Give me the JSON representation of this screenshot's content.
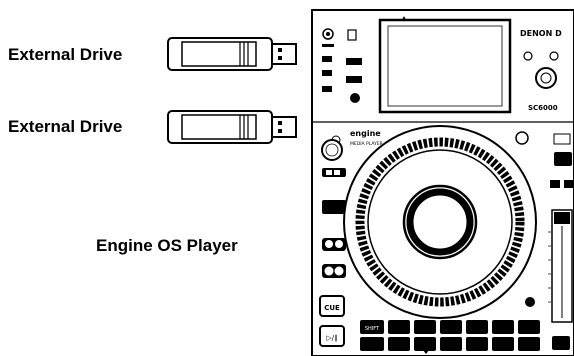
{
  "labels": {
    "drive_1": "External Drive",
    "drive_2": "External Drive",
    "player": "Engine OS Player"
  },
  "player": {
    "brand": "DENON D",
    "engine_logo": "engine",
    "engine_sub": "MEDIA PLAYER",
    "model": "SC6000",
    "cue_label": "CUE",
    "play_pause_label": "▷/∥",
    "shift_label": "SHIFT"
  },
  "colors": {
    "line": "#000000",
    "background": "#ffffff",
    "screen": "#ffffff"
  }
}
